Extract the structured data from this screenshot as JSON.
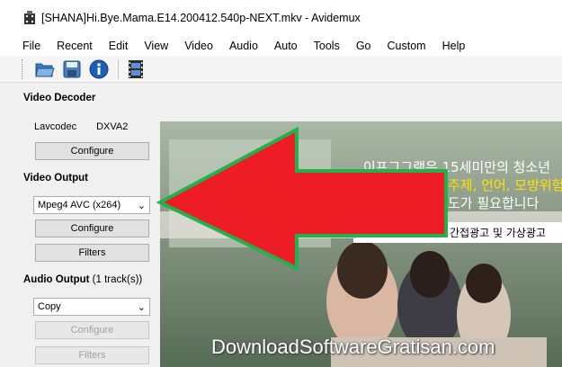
{
  "window": {
    "title": "[SHANA]Hi.Bye.Mama.E14.200412.540p-NEXT.mkv - Avidemux"
  },
  "menu": [
    "File",
    "Recent",
    "Edit",
    "View",
    "Video",
    "Audio",
    "Auto",
    "Tools",
    "Go",
    "Custom",
    "Help"
  ],
  "toolbar": {
    "icons": [
      "open-folder-icon",
      "save-disk-icon",
      "info-icon",
      "filmstrip-icon"
    ]
  },
  "video_decoder": {
    "heading": "Video Decoder",
    "codec1": "Lavcodec",
    "codec2": "DXVA2",
    "configure": "Configure"
  },
  "video_output": {
    "heading": "Video Output",
    "selected": "Mpeg4 AVC (x264)",
    "configure": "Configure",
    "filters": "Filters"
  },
  "audio_output": {
    "heading": "Audio Output",
    "tracks": "(1 track(s))",
    "selected": "Copy",
    "configure": "Configure",
    "filters": "Filters"
  },
  "preview": {
    "korean_line1": "이프그그램은 15세미만의 청소년",
    "korean_line2": "주제, 언어, 모방위험",
    "korean_line3": "도가 필요합니다",
    "korean_line4": "간접광고 및 가상광고"
  },
  "watermark": "DownloadSoftwareGratisan.com",
  "colors": {
    "arrow_fill": "#ee1c24",
    "arrow_stroke": "#22b14c",
    "window_bg": "#f0f0f0",
    "desktop": "#7a2a8c"
  }
}
